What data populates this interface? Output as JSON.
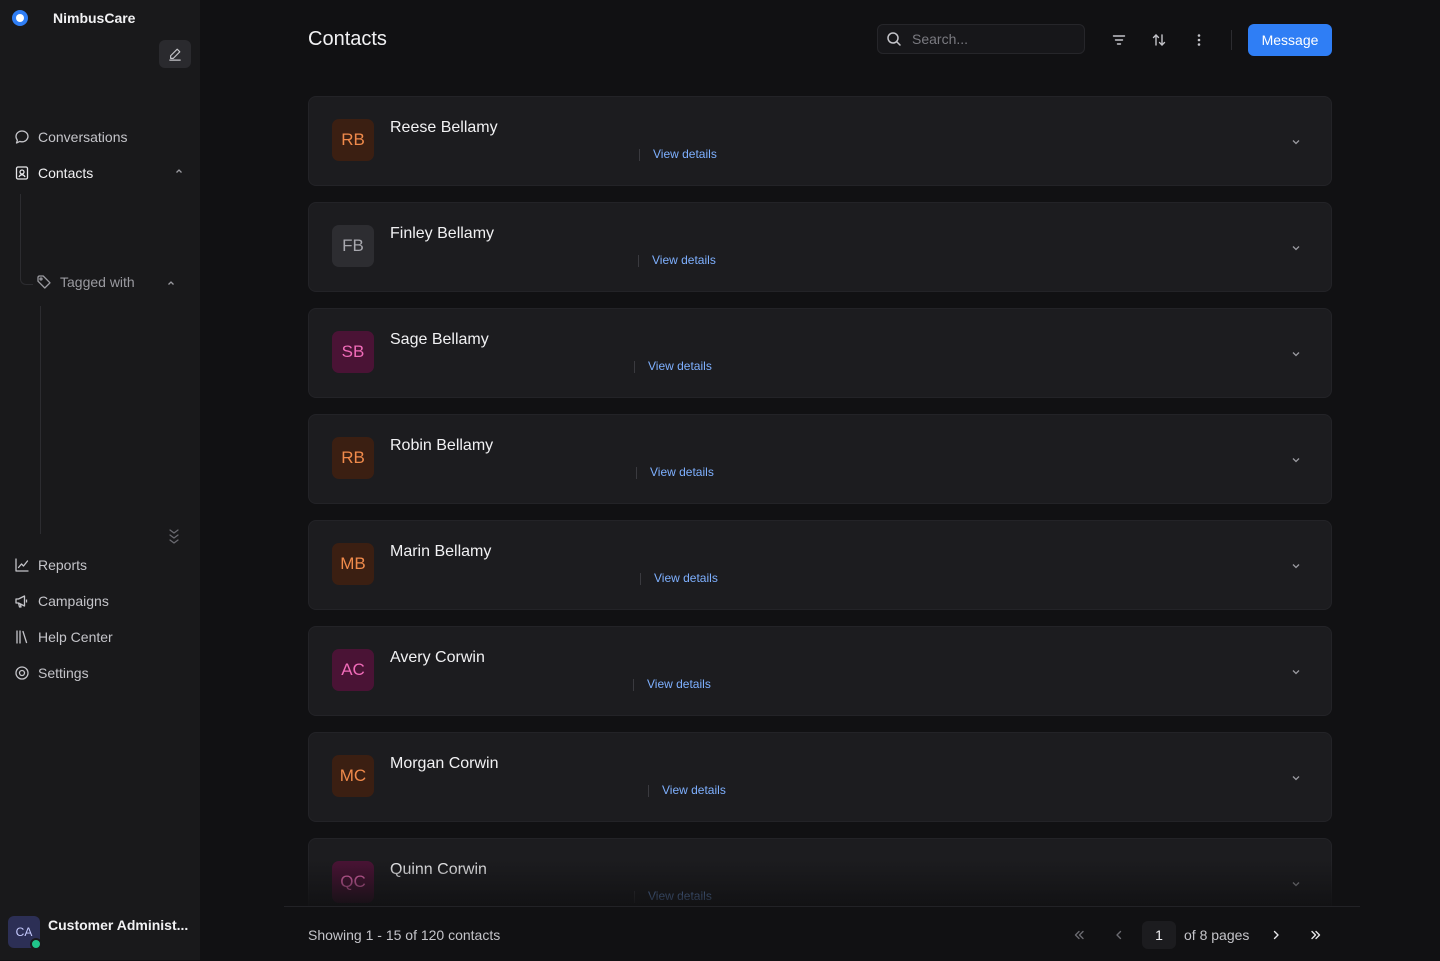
{
  "app": {
    "name": "NimbusCare",
    "brand_color": "#2f7ef5"
  },
  "sidebar": {
    "items": [
      {
        "label": "Conversations",
        "icon": "chat-bubble-icon"
      },
      {
        "label": "Contacts",
        "icon": "contact-card-icon"
      },
      {
        "label": "Tagged with",
        "icon": "tag-icon"
      },
      {
        "label": "Reports",
        "icon": "line-chart-icon"
      },
      {
        "label": "Campaigns",
        "icon": "megaphone-icon"
      },
      {
        "label": "Help Center",
        "icon": "library-icon"
      },
      {
        "label": "Settings",
        "icon": "settings-gear-icon"
      }
    ],
    "user": {
      "initials": "CA",
      "name": "Customer Administ...",
      "status": "online"
    }
  },
  "header": {
    "title": "Contacts",
    "search_placeholder": "Search...",
    "message_label": "Message"
  },
  "contacts": [
    {
      "initials": "RB",
      "name": "Reese Bellamy",
      "link": "View details",
      "avatar_color": "orange"
    },
    {
      "initials": "FB",
      "name": "Finley Bellamy",
      "link": "View details",
      "avatar_color": "gray"
    },
    {
      "initials": "SB",
      "name": "Sage Bellamy",
      "link": "View details",
      "avatar_color": "pink"
    },
    {
      "initials": "RB",
      "name": "Robin Bellamy",
      "link": "View details",
      "avatar_color": "orange"
    },
    {
      "initials": "MB",
      "name": "Marin Bellamy",
      "link": "View details",
      "avatar_color": "orange"
    },
    {
      "initials": "AC",
      "name": "Avery Corwin",
      "link": "View details",
      "avatar_color": "pink"
    },
    {
      "initials": "MC",
      "name": "Morgan Corwin",
      "link": "View details",
      "avatar_color": "orange"
    },
    {
      "initials": "QC",
      "name": "Quinn Corwin",
      "link": "View details",
      "avatar_color": "pink"
    }
  ],
  "pagination": {
    "showing": "Showing 1 - 15 of 120 contacts",
    "current_page": "1",
    "total_pages": "of 8 pages"
  }
}
